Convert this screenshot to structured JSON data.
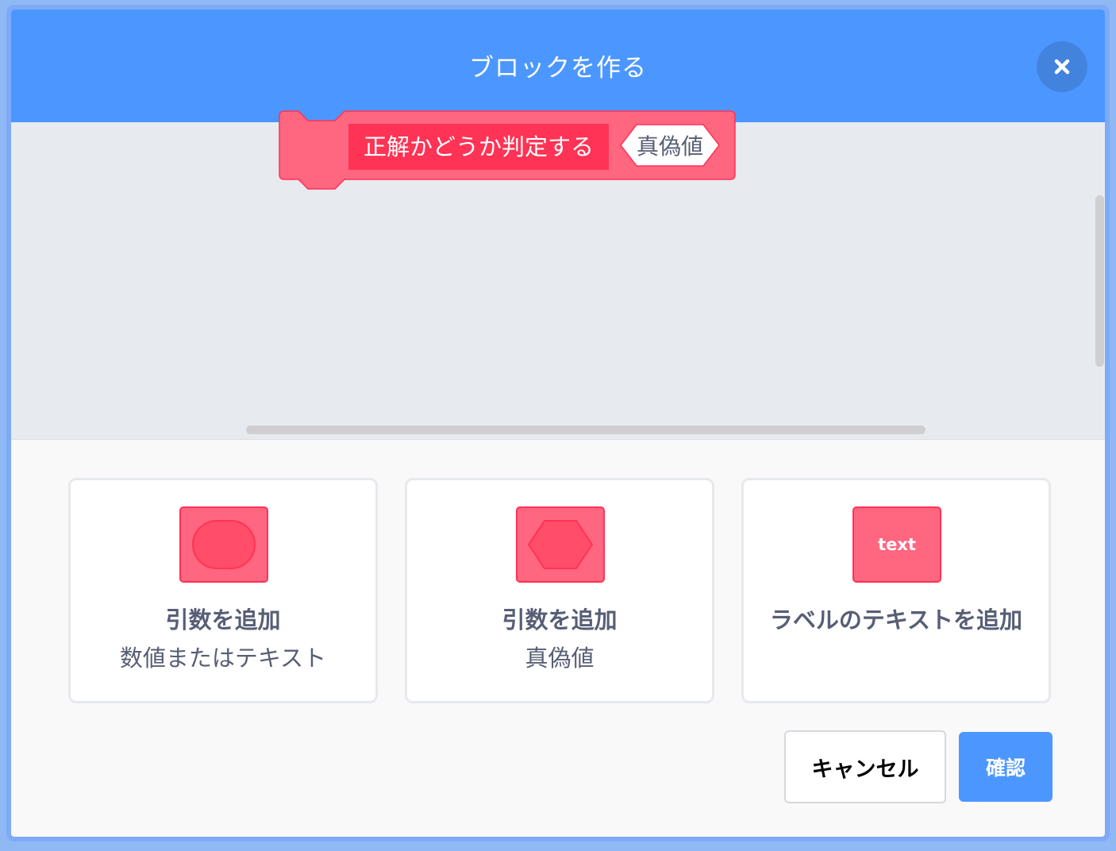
{
  "dialog": {
    "title": "ブロックを作る",
    "close_icon": "close-icon"
  },
  "preview": {
    "block_label": "正解かどうか判定する",
    "boolean_input_label": "真偽値",
    "block_color": "#ff6680",
    "label_highlight_color": "#ff3355"
  },
  "options": [
    {
      "icon": "round-input-icon",
      "title": "引数を追加",
      "subtitle": "数値またはテキスト"
    },
    {
      "icon": "boolean-input-icon",
      "title": "引数を追加",
      "subtitle": "真偽値"
    },
    {
      "icon": "text-label-icon",
      "icon_text": "text",
      "title": "ラベルのテキストを追加"
    }
  ],
  "footer": {
    "cancel_label": "キャンセル",
    "ok_label": "確認"
  },
  "colors": {
    "header": "#4c97ff",
    "accent": "#4c97ff",
    "block": "#ff6680"
  }
}
